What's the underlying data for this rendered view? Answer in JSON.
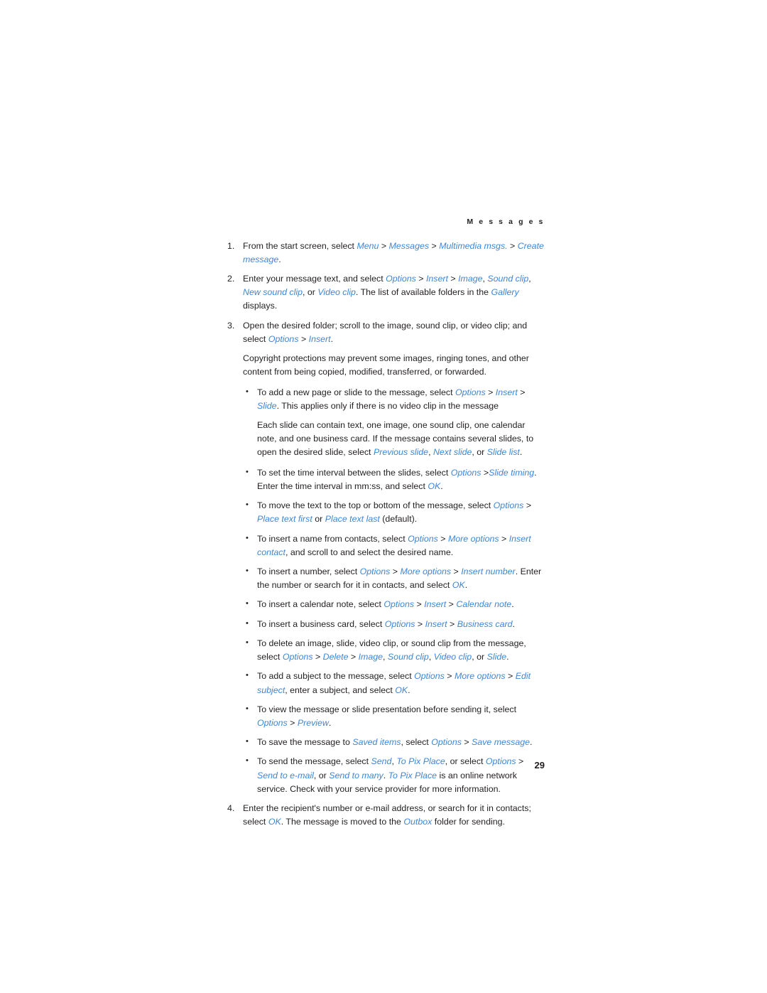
{
  "document": {
    "running_header": "M e s s a g e s",
    "page_number": "29",
    "accent_color": "#3e86d6",
    "text_color": "#231f20",
    "background_color": "#ffffff"
  },
  "steps": [
    {
      "marker": "1.",
      "text": "From the start screen, select Menu > Messages > Multimedia msgs. > Create message.",
      "parts": [
        {
          "t": "From the start screen, select ",
          "s": "plain"
        },
        {
          "t": "Menu",
          "s": "ui"
        },
        {
          "t": " > ",
          "s": "plain"
        },
        {
          "t": "Messages",
          "s": "ui"
        },
        {
          "t": " > ",
          "s": "plain"
        },
        {
          "t": "Multimedia msgs.",
          "s": "ui"
        },
        {
          "t": " > ",
          "s": "plain"
        },
        {
          "t": "Create message",
          "s": "ui"
        },
        {
          "t": ".",
          "s": "plain"
        }
      ]
    },
    {
      "marker": "2.",
      "text": "Enter your message text, and select Options > Insert > Image, Sound clip, New sound clip, or Video clip. The list of available folders in the Gallery displays.",
      "parts": [
        {
          "t": "Enter your message text, and select ",
          "s": "plain"
        },
        {
          "t": "Options",
          "s": "ui"
        },
        {
          "t": " > ",
          "s": "plain"
        },
        {
          "t": "Insert",
          "s": "ui"
        },
        {
          "t": " > ",
          "s": "plain"
        },
        {
          "t": "Image",
          "s": "ui"
        },
        {
          "t": ", ",
          "s": "plain"
        },
        {
          "t": "Sound clip",
          "s": "ui"
        },
        {
          "t": ", ",
          "s": "plain"
        },
        {
          "t": "New sound clip",
          "s": "ui"
        },
        {
          "t": ", or ",
          "s": "plain"
        },
        {
          "t": "Video clip",
          "s": "ui"
        },
        {
          "t": ". The list of available folders in the ",
          "s": "plain"
        },
        {
          "t": "Gallery",
          "s": "ui"
        },
        {
          "t": " displays.",
          "s": "plain"
        }
      ]
    },
    {
      "marker": "3.",
      "text": "Open the desired folder; scroll to the image, sound clip, or video clip; and select Options > Insert.",
      "parts": [
        {
          "t": "Open the desired folder; scroll to the image, sound clip, or video clip; and select ",
          "s": "plain"
        },
        {
          "t": "Options",
          "s": "ui"
        },
        {
          "t": " > ",
          "s": "plain"
        },
        {
          "t": "Insert",
          "s": "ui"
        },
        {
          "t": ".",
          "s": "plain"
        }
      ]
    },
    {
      "marker": "4.",
      "text": "Enter the recipient's number or e-mail address, or search for it in contacts; select OK. The message is moved to the Outbox folder for sending.",
      "parts": [
        {
          "t": "Enter the recipient's number or e-mail address, or search for it in contacts; select ",
          "s": "plain"
        },
        {
          "t": "OK",
          "s": "ui"
        },
        {
          "t": ". The message is moved to the ",
          "s": "plain"
        },
        {
          "t": "Outbox",
          "s": "ui"
        },
        {
          "t": " folder for sending.",
          "s": "plain"
        }
      ]
    }
  ],
  "copyright_note": {
    "text": "Copyright protections may prevent some images, ringing tones, and other content from being copied, modified, transferred, or forwarded.",
    "parts": [
      {
        "t": "Copyright protections may prevent some images, ringing tones, and other content from being copied, modified, transferred, or forwarded.",
        "s": "plain"
      }
    ]
  },
  "slide_note": {
    "text": "Each slide can contain text, one image, one sound clip, one calendar note, and one business card. If the message contains several slides, to open the desired slide, select Previous slide, Next slide, or Slide list.",
    "parts": [
      {
        "t": "Each slide can contain text, one image, one sound clip, one calendar note, and one business card. If the message contains several slides, to open the desired slide, select ",
        "s": "plain"
      },
      {
        "t": "Previous slide",
        "s": "ui"
      },
      {
        "t": ", ",
        "s": "plain"
      },
      {
        "t": "Next slide",
        "s": "ui"
      },
      {
        "t": ", or ",
        "s": "plain"
      },
      {
        "t": "Slide list",
        "s": "ui"
      },
      {
        "t": ".",
        "s": "plain"
      }
    ]
  },
  "bullets_group_a": [
    {
      "text": "To add a new page or slide to the message, select Options > Insert > Slide. This applies only if there is no video clip in the message",
      "parts": [
        {
          "t": "To add a new page or slide to the message, select ",
          "s": "plain"
        },
        {
          "t": "Options",
          "s": "ui"
        },
        {
          "t": " > ",
          "s": "plain"
        },
        {
          "t": "Insert",
          "s": "ui"
        },
        {
          "t": " > ",
          "s": "plain"
        },
        {
          "t": "Slide",
          "s": "ui"
        },
        {
          "t": ". This applies only if there is no video clip in the message",
          "s": "plain"
        }
      ]
    }
  ],
  "bullets_group_b": [
    {
      "text": "To set the time interval between the slides, select Options > Slide timing. Enter the time interval in mm:ss, and select OK.",
      "parts": [
        {
          "t": "To set the time interval between the slides, select ",
          "s": "plain"
        },
        {
          "t": "Options",
          "s": "ui"
        },
        {
          "t": " >",
          "s": "plain"
        },
        {
          "t": "Slide timing",
          "s": "ui"
        },
        {
          "t": ". Enter the time interval in mm:ss, and select ",
          "s": "plain"
        },
        {
          "t": "OK",
          "s": "ui"
        },
        {
          "t": ".",
          "s": "plain"
        }
      ]
    },
    {
      "text": "To move the text to the top or bottom of the message, select Options > Place text first or Place text last (default).",
      "parts": [
        {
          "t": "To move the text to the top or bottom of the message, select ",
          "s": "plain"
        },
        {
          "t": "Options",
          "s": "ui"
        },
        {
          "t": " > ",
          "s": "plain"
        },
        {
          "t": "Place text first",
          "s": "ui"
        },
        {
          "t": " or ",
          "s": "plain"
        },
        {
          "t": "Place text last",
          "s": "ui"
        },
        {
          "t": " (default).",
          "s": "plain"
        }
      ]
    },
    {
      "text": "To insert a name from contacts, select Options > More options > Insert contact, and scroll to and select the desired name.",
      "parts": [
        {
          "t": "To insert a name from contacts, select ",
          "s": "plain"
        },
        {
          "t": "Options",
          "s": "ui"
        },
        {
          "t": " > ",
          "s": "plain"
        },
        {
          "t": "More options",
          "s": "ui"
        },
        {
          "t": " > ",
          "s": "plain"
        },
        {
          "t": "Insert contact",
          "s": "ui"
        },
        {
          "t": ", and scroll to and select the desired name.",
          "s": "plain"
        }
      ]
    },
    {
      "text": "To insert a number, select Options > More options > Insert number. Enter the number or search for it in contacts, and select OK.",
      "parts": [
        {
          "t": "To insert a number, select ",
          "s": "plain"
        },
        {
          "t": "Options",
          "s": "ui"
        },
        {
          "t": " > ",
          "s": "plain"
        },
        {
          "t": "More options",
          "s": "ui"
        },
        {
          "t": " > ",
          "s": "plain"
        },
        {
          "t": "Insert number",
          "s": "ui"
        },
        {
          "t": ". Enter the number or search for it in contacts, and select ",
          "s": "plain"
        },
        {
          "t": "OK",
          "s": "ui"
        },
        {
          "t": ".",
          "s": "plain"
        }
      ]
    },
    {
      "text": "To insert a calendar note, select Options > Insert > Calendar note.",
      "parts": [
        {
          "t": "To insert a calendar note, select ",
          "s": "plain"
        },
        {
          "t": "Options",
          "s": "ui"
        },
        {
          "t": " > ",
          "s": "plain"
        },
        {
          "t": "Insert",
          "s": "ui"
        },
        {
          "t": " > ",
          "s": "plain"
        },
        {
          "t": "Calendar note",
          "s": "ui"
        },
        {
          "t": ".",
          "s": "plain"
        }
      ]
    },
    {
      "text": "To insert a business card, select Options > Insert > Business card.",
      "parts": [
        {
          "t": "To insert a business card, select ",
          "s": "plain"
        },
        {
          "t": "Options",
          "s": "ui"
        },
        {
          "t": " > ",
          "s": "plain"
        },
        {
          "t": "Insert",
          "s": "ui"
        },
        {
          "t": " > ",
          "s": "plain"
        },
        {
          "t": "Business card",
          "s": "ui"
        },
        {
          "t": ".",
          "s": "plain"
        }
      ]
    },
    {
      "text": "To delete an image, slide, video clip, or sound clip from the message, select Options > Delete > Image, Sound clip, Video clip, or Slide.",
      "parts": [
        {
          "t": "To delete an image, slide, video clip, or sound clip from the message, select ",
          "s": "plain"
        },
        {
          "t": "Options",
          "s": "ui"
        },
        {
          "t": " > ",
          "s": "plain"
        },
        {
          "t": "Delete",
          "s": "ui"
        },
        {
          "t": " > ",
          "s": "plain"
        },
        {
          "t": "Image",
          "s": "ui"
        },
        {
          "t": ", ",
          "s": "plain"
        },
        {
          "t": "Sound clip",
          "s": "ui"
        },
        {
          "t": ", ",
          "s": "plain"
        },
        {
          "t": "Video clip",
          "s": "ui"
        },
        {
          "t": ", or ",
          "s": "plain"
        },
        {
          "t": "Slide",
          "s": "ui"
        },
        {
          "t": ".",
          "s": "plain"
        }
      ]
    },
    {
      "text": "To add a subject to the message, select Options > More options > Edit subject, enter a subject, and select OK.",
      "parts": [
        {
          "t": "To add a subject to the message, select ",
          "s": "plain"
        },
        {
          "t": "Options",
          "s": "ui"
        },
        {
          "t": " > ",
          "s": "plain"
        },
        {
          "t": "More options",
          "s": "ui"
        },
        {
          "t": " > ",
          "s": "plain"
        },
        {
          "t": "Edit subject",
          "s": "ui"
        },
        {
          "t": ", enter a subject, and select ",
          "s": "plain"
        },
        {
          "t": "OK",
          "s": "ui"
        },
        {
          "t": ".",
          "s": "plain"
        }
      ]
    },
    {
      "text": "To view the message or slide presentation before sending it, select Options > Preview.",
      "parts": [
        {
          "t": "To view the message or slide presentation before sending it, select ",
          "s": "plain"
        },
        {
          "t": "Options",
          "s": "ui"
        },
        {
          "t": " > ",
          "s": "plain"
        },
        {
          "t": "Preview",
          "s": "ui"
        },
        {
          "t": ".",
          "s": "plain"
        }
      ]
    },
    {
      "text": "To save the message to Saved items, select Options > Save message.",
      "parts": [
        {
          "t": "To save the message to ",
          "s": "plain"
        },
        {
          "t": "Saved items",
          "s": "ui"
        },
        {
          "t": ", select ",
          "s": "plain"
        },
        {
          "t": "Options",
          "s": "ui"
        },
        {
          "t": " > ",
          "s": "plain"
        },
        {
          "t": "Save message",
          "s": "ui"
        },
        {
          "t": ".",
          "s": "plain"
        }
      ]
    },
    {
      "text": "To send the message, select Send, To Pix Place, or select Options > Send to e-mail, or Send to many. To Pix Place is an online network service. Check with your service provider for more information.",
      "parts": [
        {
          "t": "To send the message, select ",
          "s": "plain"
        },
        {
          "t": "Send",
          "s": "ui"
        },
        {
          "t": ", ",
          "s": "plain"
        },
        {
          "t": "To Pix Place",
          "s": "ui"
        },
        {
          "t": ", or select ",
          "s": "plain"
        },
        {
          "t": "Options",
          "s": "ui"
        },
        {
          "t": " > ",
          "s": "plain"
        },
        {
          "t": "Send to e-mail",
          "s": "ui"
        },
        {
          "t": ", or ",
          "s": "plain"
        },
        {
          "t": "Send to many",
          "s": "ui"
        },
        {
          "t": ". ",
          "s": "plain"
        },
        {
          "t": "To Pix Place",
          "s": "ui"
        },
        {
          "t": " is an online network service. Check with your service provider for more information.",
          "s": "plain"
        }
      ]
    }
  ],
  "bullet_glyph": "•"
}
